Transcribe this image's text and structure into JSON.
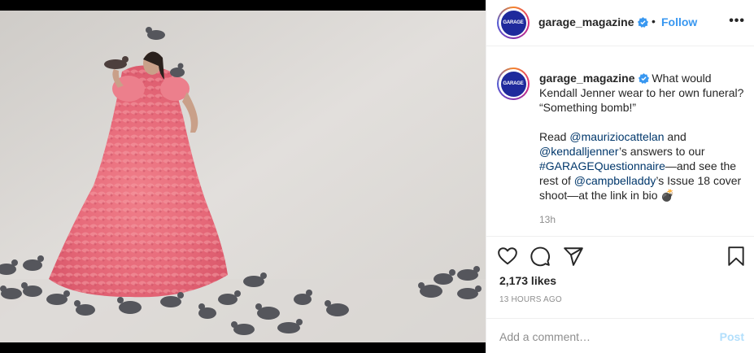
{
  "post": {
    "username": "garage_magazine",
    "avatar_text": "GARAGE",
    "separator": "•",
    "follow_label": "Follow",
    "more_label": "•••",
    "caption": {
      "line1": "What would Kendall Jenner wear to her own funeral? “Something bomb!”",
      "read": "Read ",
      "mention1": "@mauriziocattelan",
      "and": " and",
      "mention2": "@kendalljenner",
      "answers": "’s answers to our",
      "hashtag": "#GARAGEQuestionnaire",
      "see": "—and see the rest of ",
      "mention3": "@campbelladdy",
      "rest": "’s Issue 18 cover shoot—at the link in bio 💣"
    },
    "caption_time": "13h",
    "likes": "2,173 likes",
    "posted": "13 HOURS AGO"
  },
  "comment": {
    "placeholder": "Add a comment…",
    "post_label": "Post"
  },
  "icons": {
    "heart": "heart-icon",
    "comment": "comment-icon",
    "share": "share-icon",
    "save": "bookmark-icon",
    "verified": "verified-badge-icon"
  },
  "colors": {
    "accent": "#3897f0",
    "verified": "#3897f0",
    "mention": "#00376b",
    "muted": "#8e8e8e",
    "post_disabled": "#b2dffc",
    "brand_avatar": "#1f2a9c"
  }
}
